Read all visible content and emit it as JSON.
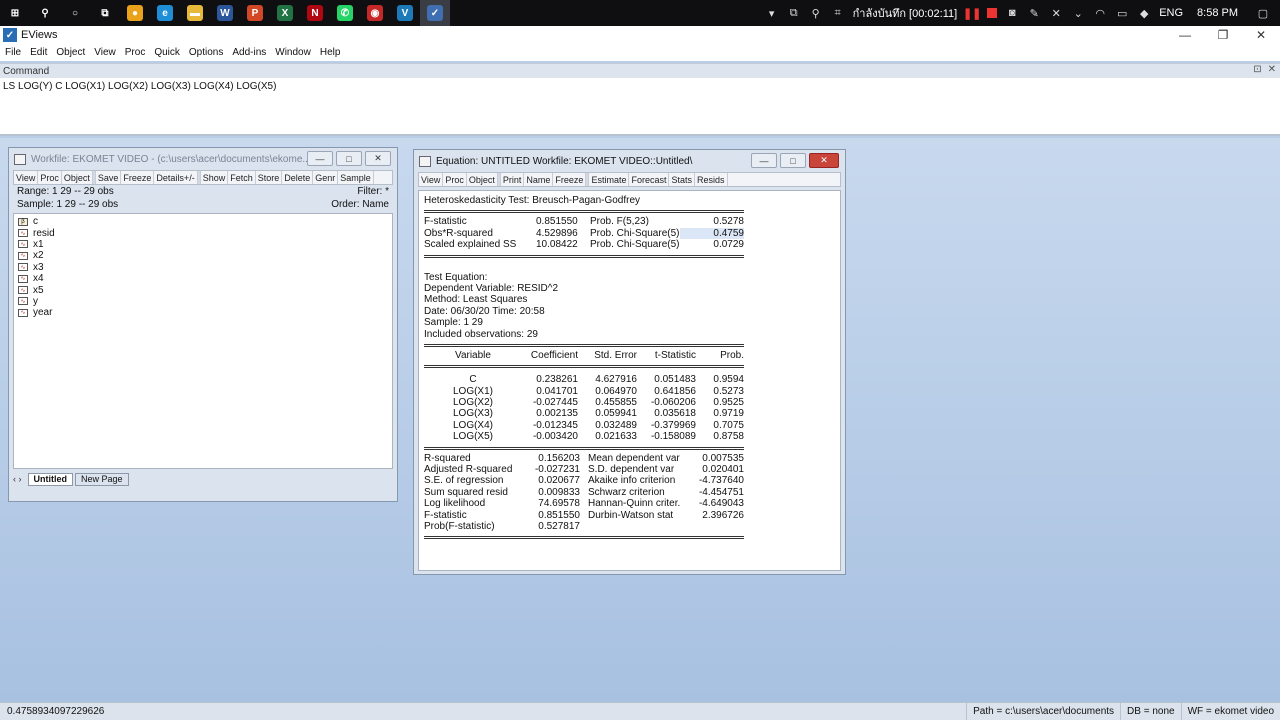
{
  "taskbar": {
    "apps": [
      {
        "name": "start-menu-icon",
        "glyph": "⊞",
        "color": "#0f0f12"
      },
      {
        "name": "search-icon",
        "glyph": "⚲",
        "color": "#0f0f12"
      },
      {
        "name": "cortana-icon",
        "glyph": "○",
        "color": "#0f0f12"
      },
      {
        "name": "task-view-icon",
        "glyph": "⧉",
        "color": "#0f0f12"
      },
      {
        "name": "chrome-icon",
        "glyph": "●",
        "color": "#e9a219"
      },
      {
        "name": "edge-icon",
        "glyph": "e",
        "color": "#1e8fd6"
      },
      {
        "name": "file-explorer-icon",
        "glyph": "▬",
        "color": "#e8b83a"
      },
      {
        "name": "word-icon",
        "glyph": "W",
        "color": "#2b579a"
      },
      {
        "name": "powerpoint-icon",
        "glyph": "P",
        "color": "#d24726"
      },
      {
        "name": "excel-icon",
        "glyph": "X",
        "color": "#217346"
      },
      {
        "name": "netflix-icon",
        "glyph": "N",
        "color": "#b00710"
      },
      {
        "name": "whatsapp-icon",
        "glyph": "✆",
        "color": "#25d366"
      },
      {
        "name": "recorder-icon",
        "glyph": "◉",
        "color": "#c62828"
      },
      {
        "name": "visio-icon",
        "glyph": "V",
        "color": "#1d7ab8"
      },
      {
        "name": "eviews-icon",
        "glyph": "✓",
        "color": "#3f6fb0"
      }
    ],
    "recording_label": "กำลังบันทึก [00:02:11]",
    "language": "ENG",
    "clock": "8:58 PM"
  },
  "app": {
    "title": "EViews",
    "menu": [
      "File",
      "Edit",
      "Object",
      "View",
      "Proc",
      "Quick",
      "Options",
      "Add-ins",
      "Window",
      "Help"
    ]
  },
  "command": {
    "header": "Command",
    "text": "LS LOG(Y) C LOG(X1) LOG(X2) LOG(X3) LOG(X4) LOG(X5)"
  },
  "workfile": {
    "title": "Workfile: EKOMET VIDEO - (c:\\users\\acer\\documents\\ekome...",
    "toolbar": [
      "View",
      "Proc",
      "Object",
      "|",
      "Save",
      "Freeze",
      "Details+/-",
      "|",
      "Show",
      "Fetch",
      "Store",
      "Delete",
      "Genr",
      "Sample"
    ],
    "range_label": "Range:  1 29  --  29 obs",
    "filter_label": "Filter: *",
    "sample_label": "Sample: 1 29  --  29 obs",
    "order_label": "Order: Name",
    "objects": [
      {
        "label": "c",
        "kind": "coef"
      },
      {
        "label": "resid",
        "kind": "series"
      },
      {
        "label": "x1",
        "kind": "series"
      },
      {
        "label": "x2",
        "kind": "series"
      },
      {
        "label": "x3",
        "kind": "series"
      },
      {
        "label": "x4",
        "kind": "series"
      },
      {
        "label": "x5",
        "kind": "series"
      },
      {
        "label": "y",
        "kind": "series"
      },
      {
        "label": "year",
        "kind": "series"
      }
    ],
    "tabs": [
      "Untitled",
      "New Page"
    ]
  },
  "equation": {
    "title": "Equation: UNTITLED   Workfile: EKOMET VIDEO::Untitled\\",
    "toolbar": [
      "View",
      "Proc",
      "Object",
      "|",
      "Print",
      "Name",
      "Freeze",
      "|",
      "Estimate",
      "Forecast",
      "Stats",
      "Resids"
    ],
    "heading": "Heteroskedasticity Test: Breusch-Pagan-Godfrey",
    "summary": [
      [
        "F-statistic",
        "0.851550",
        "Prob. F(5,23)",
        "0.5278"
      ],
      [
        "Obs*R-squared",
        "4.529896",
        "Prob. Chi-Square(5)",
        "0.4759"
      ],
      [
        "Scaled explained SS",
        "10.08422",
        "Prob. Chi-Square(5)",
        "0.0729"
      ]
    ],
    "info": [
      "Test Equation:",
      "Dependent Variable: RESID^2",
      "Method: Least Squares",
      "Date: 06/30/20   Time: 20:58",
      "Sample: 1 29",
      "Included observations: 29"
    ],
    "coef_headers": [
      "Variable",
      "Coefficient",
      "Std. Error",
      "t-Statistic",
      "Prob."
    ],
    "coef_rows": [
      [
        "C",
        "0.238261",
        "4.627916",
        "0.051483",
        "0.9594"
      ],
      [
        "LOG(X1)",
        "0.041701",
        "0.064970",
        "0.641856",
        "0.5273"
      ],
      [
        "LOG(X2)",
        "-0.027445",
        "0.455855",
        "-0.060206",
        "0.9525"
      ],
      [
        "LOG(X3)",
        "0.002135",
        "0.059941",
        "0.035618",
        "0.9719"
      ],
      [
        "LOG(X4)",
        "-0.012345",
        "0.032489",
        "-0.379969",
        "0.7075"
      ],
      [
        "LOG(X5)",
        "-0.003420",
        "0.021633",
        "-0.158089",
        "0.8758"
      ]
    ],
    "stats_rows": [
      [
        "R-squared",
        "0.156203",
        "Mean dependent var",
        "0.007535"
      ],
      [
        "Adjusted R-squared",
        "-0.027231",
        "S.D. dependent var",
        "0.020401"
      ],
      [
        "S.E. of regression",
        "0.020677",
        "Akaike info criterion",
        "-4.737640"
      ],
      [
        "Sum squared resid",
        "0.009833",
        "Schwarz criterion",
        "-4.454751"
      ],
      [
        "Log likelihood",
        "74.69578",
        "Hannan-Quinn criter.",
        "-4.649043"
      ],
      [
        "F-statistic",
        "0.851550",
        "Durbin-Watson stat",
        "2.396726"
      ],
      [
        "Prob(F-statistic)",
        "0.527817",
        "",
        ""
      ]
    ]
  },
  "statusbar": {
    "value": "0.4758934097229626",
    "path": "Path = c:\\users\\acer\\documents",
    "db": "DB = none",
    "wf": "WF = ekomet video"
  }
}
